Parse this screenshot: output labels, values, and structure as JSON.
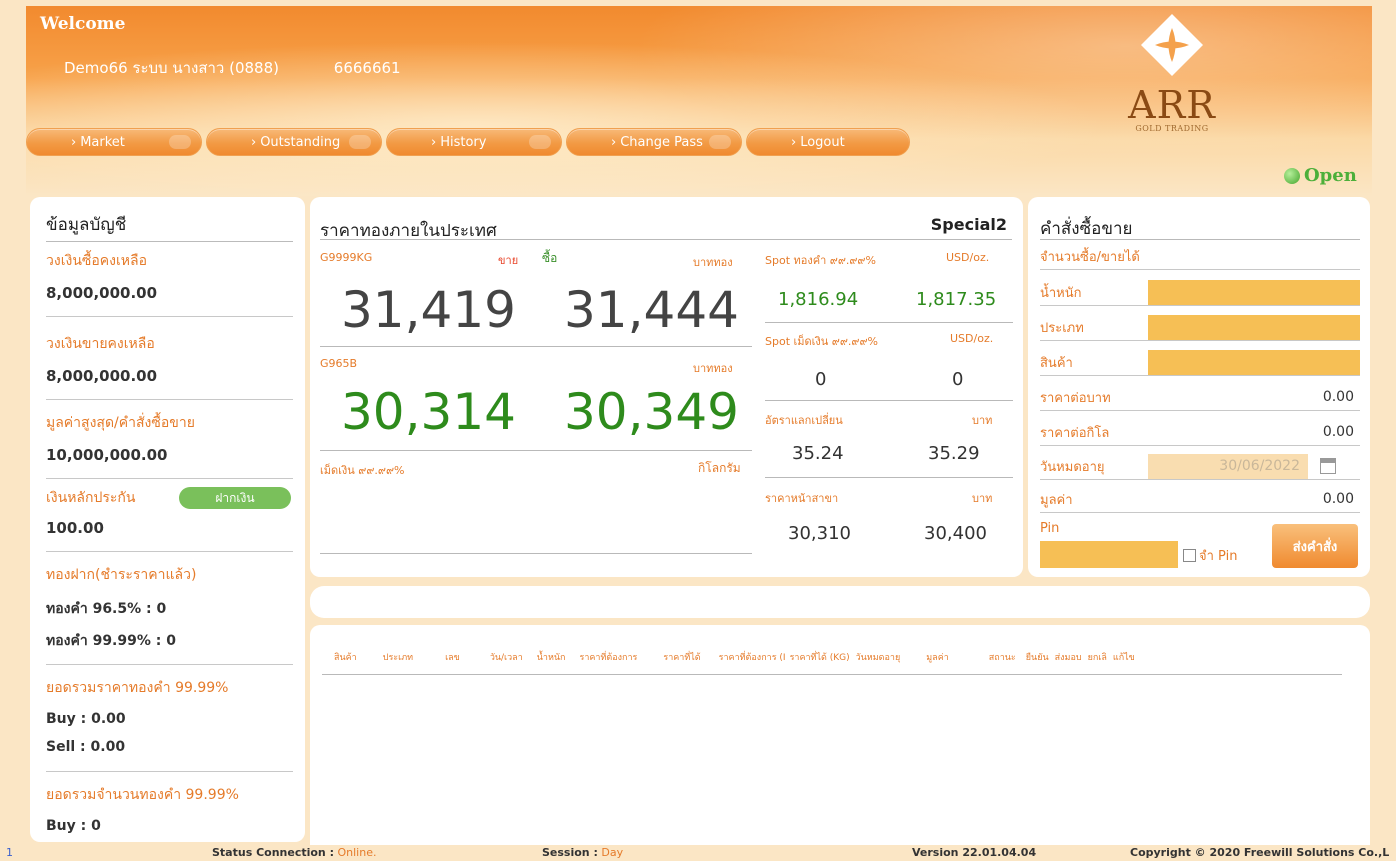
{
  "header": {
    "welcome": "Welcome",
    "user_name": "Demo66 ระบบ นางสาว (0888)",
    "account_no": "6666661",
    "nav": [
      "Market",
      "Outstanding",
      "History",
      "Change Pass",
      "Logout"
    ],
    "logo_text": "ARR",
    "logo_sub": "GOLD TRADING",
    "market_status": "Open",
    "status_color": "#43a52c"
  },
  "account": {
    "title": "ข้อมูลบัญชี",
    "buy_limit_label": "วงเงินซื้อคงเหลือ",
    "buy_limit_value": "8,000,000.00",
    "sell_limit_label": "วงเงินขายคงเหลือ",
    "sell_limit_value": "8,000,000.00",
    "max_order_label": "มูลค่าสูงสุด/คำสั่งซื้อขาย",
    "max_order_value": "10,000,000.00",
    "collateral_label": "เงินหลักประกัน",
    "deposit_button": "ฝากเงิน",
    "collateral_value": "100.00",
    "deposit_gold_label": "ทองฝาก(ชำระราคาแล้ว)",
    "gold_965": "ทองคำ 96.5%    :  0",
    "gold_9999": "ทองคำ 99.99%   :  0",
    "total_price_label": "ยอดรวมราคาทองคำ 99.99%",
    "total_buy": "Buy :  0.00",
    "total_sell": "Sell :  0.00",
    "total_qty_label": "ยอดรวมจำนวนทองคำ 99.99%",
    "qty_buy": "Buy :  0"
  },
  "prices": {
    "title": "ราคาทองภายในประเทศ",
    "special": "Special2",
    "g9999_label": "G9999KG",
    "sell_label": "ขาย",
    "buy_label": "ซื้อ",
    "unit_baht_gold": "บาททอง",
    "g9999_sell": "31,419",
    "g9999_buy": "31,444",
    "g965_label": "G965B",
    "g965_unit": "บาททอง",
    "g965_sell": "30,314",
    "g965_buy": "30,349",
    "grain_label": "เม็ดเงิน ๙๙.๙๙%",
    "kilogram": "กิโลกรัม",
    "spot_gold_label": "Spot ทองคำ ๙๙.๙๙%",
    "usd_oz": "USD/oz.",
    "spot_gold_bid": "1,816.94",
    "spot_gold_ask": "1,817.35",
    "spot_silver_label": "Spot เม็ดเงิน ๙๙.๙๙%",
    "usd_oz2": "USD/oz.",
    "spot_silver_bid": "0",
    "spot_silver_ask": "0",
    "fx_label": "อัตราแลกเปลี่ยน",
    "baht": "บาท",
    "fx_bid": "35.24",
    "fx_ask": "35.29",
    "branch_label": "ราคาหน้าสาขา",
    "baht2": "บาท",
    "branch_bid": "30,310",
    "branch_ask": "30,400"
  },
  "order": {
    "title": "คำสั่งซื้อขาย",
    "qty_label": "จำนวนซื้อ/ขายได้",
    "weight_label": "น้ำหนัก",
    "type_label": "ประเภท",
    "product_label": "สินค้า",
    "price_per_baht_label": "ราคาต่อบาท",
    "price_per_baht": "0.00",
    "price_per_kg_label": "ราคาต่อกิโล",
    "price_per_kg": "0.00",
    "expiry_label": "วันหมดอายุ",
    "expiry_value": "30/06/2022",
    "value_label": "มูลค่า",
    "value": "0.00",
    "pin_label": "Pin",
    "remember_pin": "จำ Pin",
    "send_button": "ส่งคำสั่ง"
  },
  "table": {
    "columns": [
      "สินค้า",
      "ประเภท",
      "เลข",
      "วัน/เวลา",
      "น้ำหนัก",
      "ราคาที่ต้องการ",
      "ราคาที่ได้",
      "ราคาที่ต้องการ (I",
      "ราคาที่ได้ (KG)",
      "วันหมดอายุ",
      "มูลค่า",
      "สถานะ",
      "ยืนยัน",
      "ส่งมอบ",
      "ยกเลิ",
      "แก้ไข"
    ]
  },
  "footer": {
    "left_marker": "1",
    "status_label": "Status Connection :",
    "status_value": "Online.",
    "session_label": "Session :",
    "session_value": "Day",
    "version": "Version 22.01.04.04",
    "copyright": "Copyright © 2020 Freewill Solutions Co.,L"
  }
}
